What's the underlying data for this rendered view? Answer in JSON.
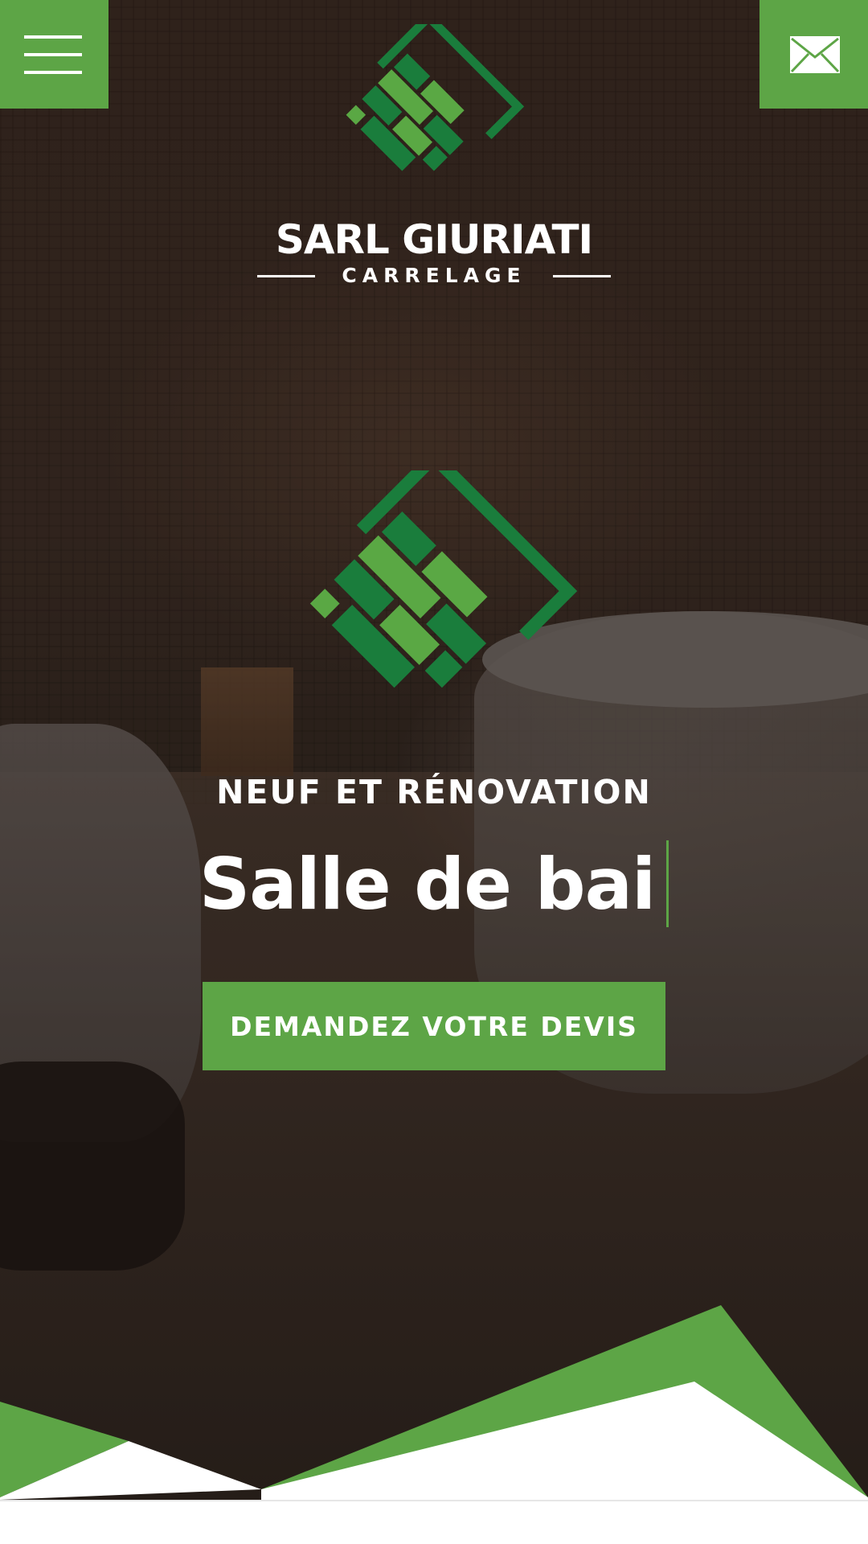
{
  "brand": {
    "name": "SARL GIURIATI",
    "subtitle": "CARRELAGE"
  },
  "hero": {
    "kicker": "NEUF ET RÉNOVATION",
    "headline": "Salle de bai",
    "cta_label": "DEMANDEZ VOTRE DEVIS"
  },
  "header": {
    "menu_icon": "hamburger-icon",
    "mail_icon": "envelope-icon"
  },
  "colors": {
    "accent_green": "#5da546",
    "dark_green": "#1a7d3c",
    "light_green": "#5aa844"
  }
}
